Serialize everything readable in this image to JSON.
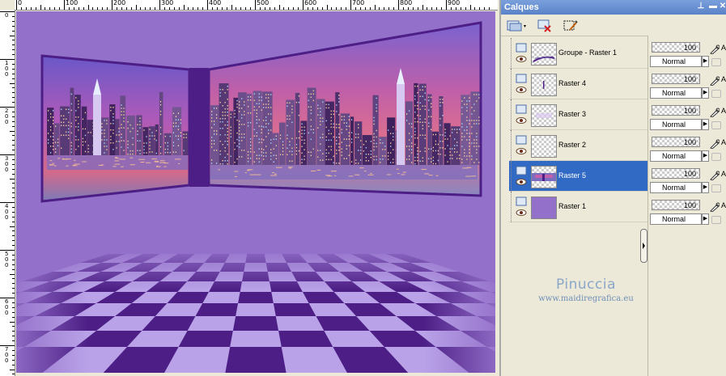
{
  "colors": {
    "background": "#9370c9",
    "dark_violet": "#4d1f86",
    "panel_title": "#5a82c8",
    "selection": "#316ac5",
    "watermark": "#8aa7c9"
  },
  "ruler": {
    "top_ticks": [
      "0",
      "100",
      "200",
      "300",
      "400",
      "500",
      "600",
      "700",
      "800",
      "900"
    ],
    "left_ticks": [
      "0",
      "100",
      "200",
      "300",
      "400",
      "500",
      "600",
      "700"
    ]
  },
  "panel": {
    "title": "Calques",
    "title_buttons": [
      "pin-icon",
      "minimize-icon",
      "close-icon"
    ],
    "toolbar": [
      "new-raster-layer-icon",
      "delete-layer-icon",
      "mask-icon"
    ]
  },
  "layers": [
    {
      "name": "Groupe - Raster 1",
      "opacity": "100",
      "blend": "Normal",
      "selected": false,
      "thumb": "group"
    },
    {
      "name": "Raster 4",
      "opacity": "100",
      "blend": "Normal",
      "selected": false,
      "thumb": "line"
    },
    {
      "name": "Raster 3",
      "opacity": "100",
      "blend": "Normal",
      "selected": false,
      "thumb": "light"
    },
    {
      "name": "Raster 2",
      "opacity": "100",
      "blend": "Normal",
      "selected": false,
      "thumb": "empty"
    },
    {
      "name": "Raster 5",
      "opacity": "100",
      "blend": "Normal",
      "selected": true,
      "thumb": "city"
    },
    {
      "name": "Raster 1",
      "opacity": "100",
      "blend": "Normal",
      "selected": false,
      "thumb": "purple"
    }
  ],
  "lock_letter": "A",
  "watermark": {
    "name": "Pinuccia",
    "url": "www.maidiregrafica.eu"
  }
}
